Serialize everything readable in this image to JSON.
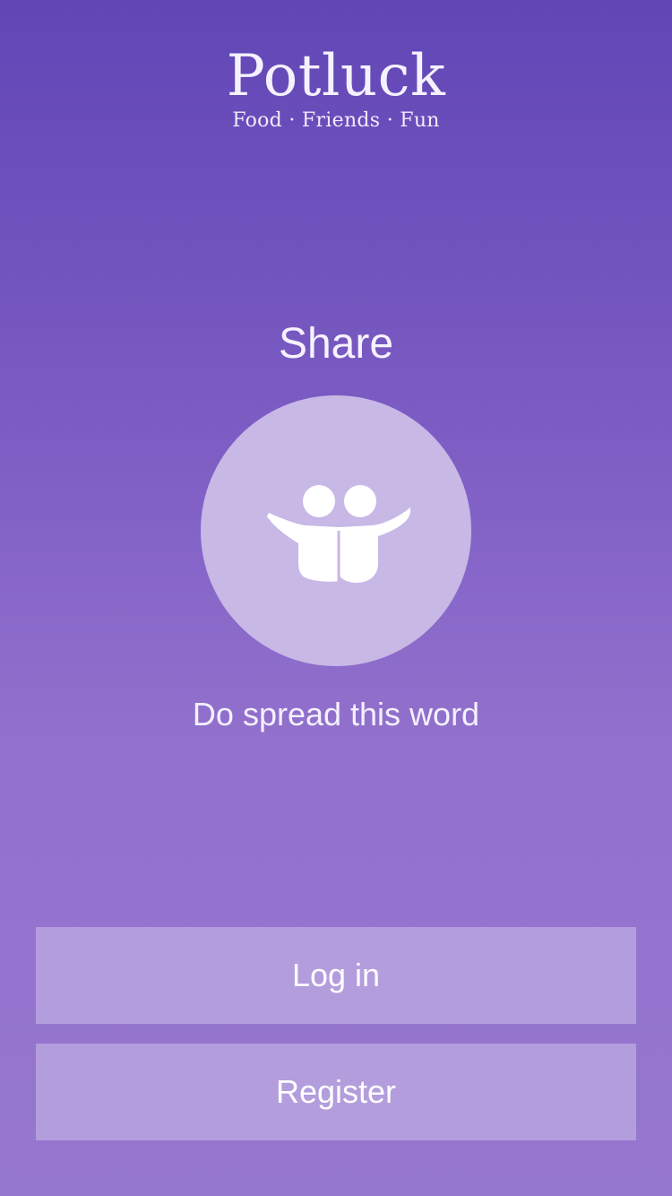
{
  "brand": {
    "title": "Potluck",
    "tagline": "Food · Friends · Fun"
  },
  "onboarding": {
    "heading": "Share",
    "illustration_icon": "friends-hugging-icon",
    "subtitle": "Do spread this word"
  },
  "actions": {
    "login_label": "Log in",
    "register_label": "Register"
  },
  "colors": {
    "background_top": "#6146b6",
    "background_bottom": "#9677cf",
    "circle": "#c8b8e6",
    "button": "#b39ddc",
    "text": "#ffffff"
  }
}
